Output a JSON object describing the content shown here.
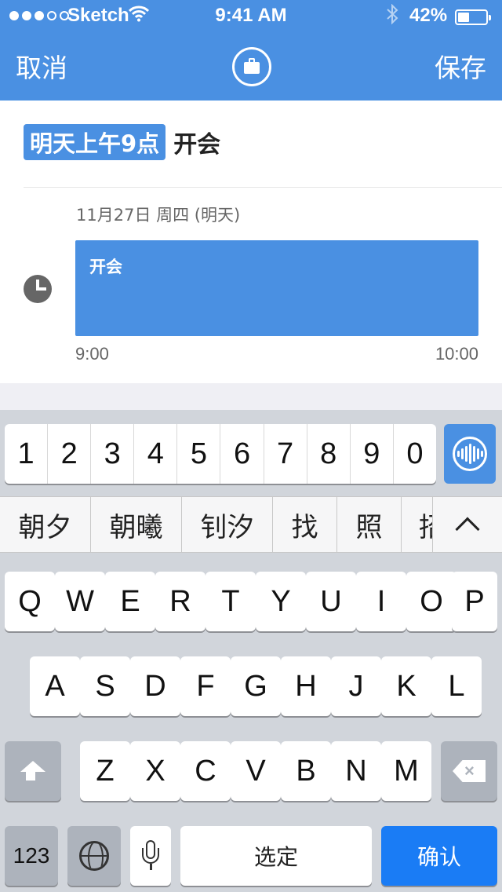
{
  "status_bar": {
    "carrier": "Sketch",
    "time": "9:41 AM",
    "battery_percent": "42%",
    "battery_level": 0.42,
    "signal_bars_filled": 3,
    "signal_bars_total": 5
  },
  "nav": {
    "cancel_label": "取消",
    "save_label": "保存",
    "center_icon": "briefcase-icon"
  },
  "event": {
    "time_chip": "明天上午9点",
    "title": "开会",
    "date_line": "11月27日 周四 (明天)",
    "block_title": "开会",
    "start_time": "9:00",
    "end_time": "10:00"
  },
  "keyboard": {
    "numbers": [
      "1",
      "2",
      "3",
      "4",
      "5",
      "6",
      "7",
      "8",
      "9",
      "0"
    ],
    "voice_icon": "voice-wave-icon",
    "candidates": [
      "朝夕",
      "朝曦",
      "钊汐",
      "找",
      "照",
      "招"
    ],
    "row1": [
      "Q",
      "W",
      "E",
      "R",
      "T",
      "Y",
      "U",
      "I",
      "O",
      "P"
    ],
    "row2": [
      "A",
      "S",
      "D",
      "F",
      "G",
      "H",
      "J",
      "K",
      "L"
    ],
    "row3": [
      "Z",
      "X",
      "C",
      "V",
      "B",
      "N",
      "M"
    ],
    "numbers_switch_label": "123",
    "space_label": "选定",
    "confirm_label": "确认"
  },
  "colors": {
    "accent": "#4a90e2",
    "confirm_key": "#1a7cf5",
    "keyboard_bg": "#d1d5db"
  }
}
